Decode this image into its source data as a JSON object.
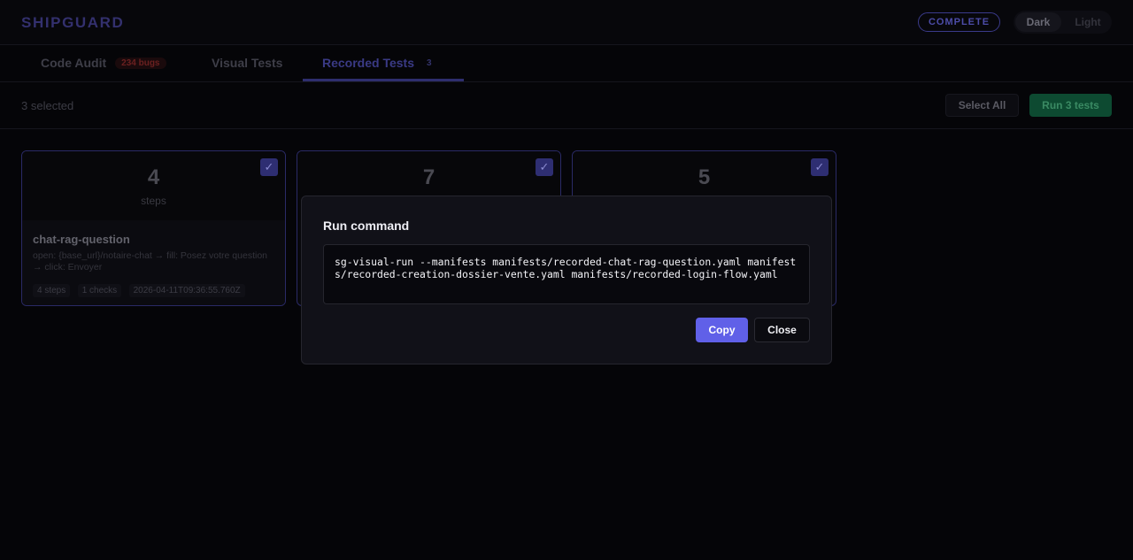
{
  "header": {
    "brand": "SHIPGUARD",
    "status": "COMPLETE",
    "theme": {
      "dark_label": "Dark",
      "light_label": "Light",
      "selected": "Dark"
    }
  },
  "tabs": [
    {
      "label": "Code Audit",
      "badge": "234 bugs"
    },
    {
      "label": "Visual Tests"
    },
    {
      "label": "Recorded Tests",
      "badge": "3",
      "active": true
    }
  ],
  "toolbar": {
    "selected_text": "3 selected",
    "select_all_label": "Select All",
    "run_label": "Run 3 tests"
  },
  "cards": [
    {
      "steps": "4",
      "steps_label": "steps",
      "checked": true,
      "name": "chat-rag-question",
      "description": "open: {base_url}/notaire-chat → fill: Posez votre question → click: Envoyer",
      "meta": [
        "4 steps",
        "1 checks",
        "2026-04-11T09:36:55.760Z"
      ]
    },
    {
      "steps": "7",
      "checked": true
    },
    {
      "steps": "5",
      "checked": true
    }
  ],
  "modal": {
    "title": "Run command",
    "command": "sg-visual-run --manifests manifests/recorded-chat-rag-question.yaml manifests/recorded-creation-dossier-vente.yaml manifests/recorded-login-flow.yaml",
    "copy_label": "Copy",
    "close_label": "Close"
  },
  "check_glyph": "✓"
}
